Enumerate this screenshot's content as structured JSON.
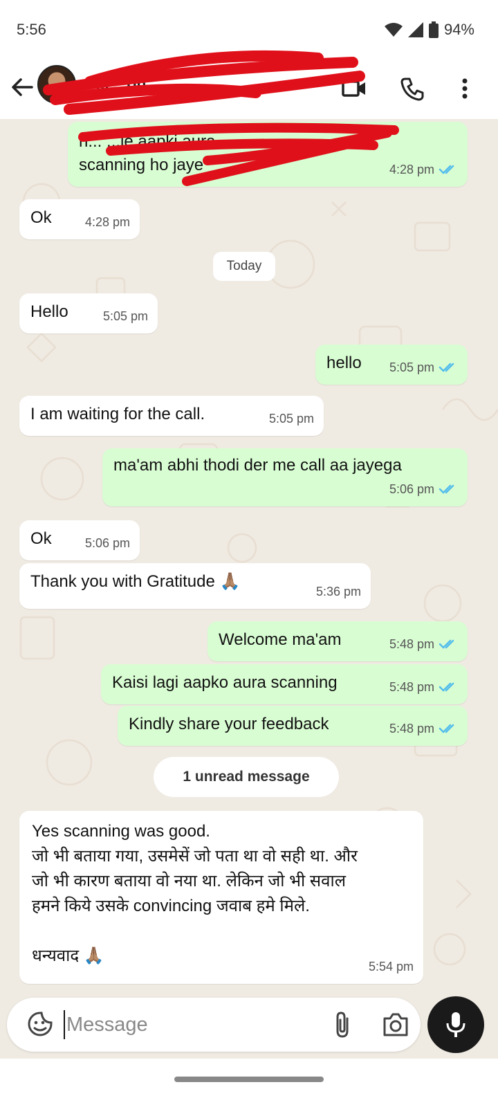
{
  "status": {
    "time": "5:56",
    "battery": "94%"
  },
  "header": {
    "contact_name": "D... ...on..."
  },
  "date_pill": "Today",
  "messages": {
    "m0": {
      "text_line1": "h...                   ...je aapki aura",
      "text_line2": "scanning ho jaye",
      "time": "4:28 pm"
    },
    "m1": {
      "text": "Ok",
      "time": "4:28 pm"
    },
    "m2": {
      "text": "Hello",
      "time": "5:05 pm"
    },
    "m3": {
      "text": "hello",
      "time": "5:05 pm"
    },
    "m4": {
      "text": "I am waiting for the call.",
      "time": "5:05 pm"
    },
    "m5": {
      "text": "ma'am abhi thodi der me call aa jayega",
      "time": "5:06 pm"
    },
    "m6": {
      "text": "Ok",
      "time": "5:06 pm"
    },
    "m7": {
      "text": "Thank you with Gratitude 🙏🏽",
      "time": "5:36 pm"
    },
    "m8": {
      "text": "Welcome ma'am",
      "time": "5:48 pm"
    },
    "m9": {
      "text": "Kaisi lagi aapko aura scanning",
      "time": "5:48 pm"
    },
    "m10": {
      "text": "Kindly share your feedback",
      "time": "5:48 pm"
    },
    "m11": {
      "text": "Yes scanning was good.\nजो भी बताया गया, उसमेसें जो पता था वो सही था. और\nजो भी कारण बताया वो नया था. लेकिन जो भी सवाल\nहमने किये उसके convincing जवाब हमे मिले.\n\nधन्यवाद 🙏🏽",
      "time": "5:54 pm"
    }
  },
  "unread_label": "1 unread message",
  "composer": {
    "placeholder": "Message"
  },
  "colors": {
    "chat_bg": "#efeae2",
    "outgoing_bubble": "#d9fdd3",
    "incoming_bubble": "#ffffff",
    "read_ticks": "#53bdeb",
    "mic_button": "#1a1a1a"
  },
  "icons": [
    "back-arrow-icon",
    "video-call-icon",
    "voice-call-icon",
    "more-options-icon",
    "sticker-icon",
    "attach-icon",
    "camera-icon",
    "mic-icon",
    "double-check-icon"
  ]
}
